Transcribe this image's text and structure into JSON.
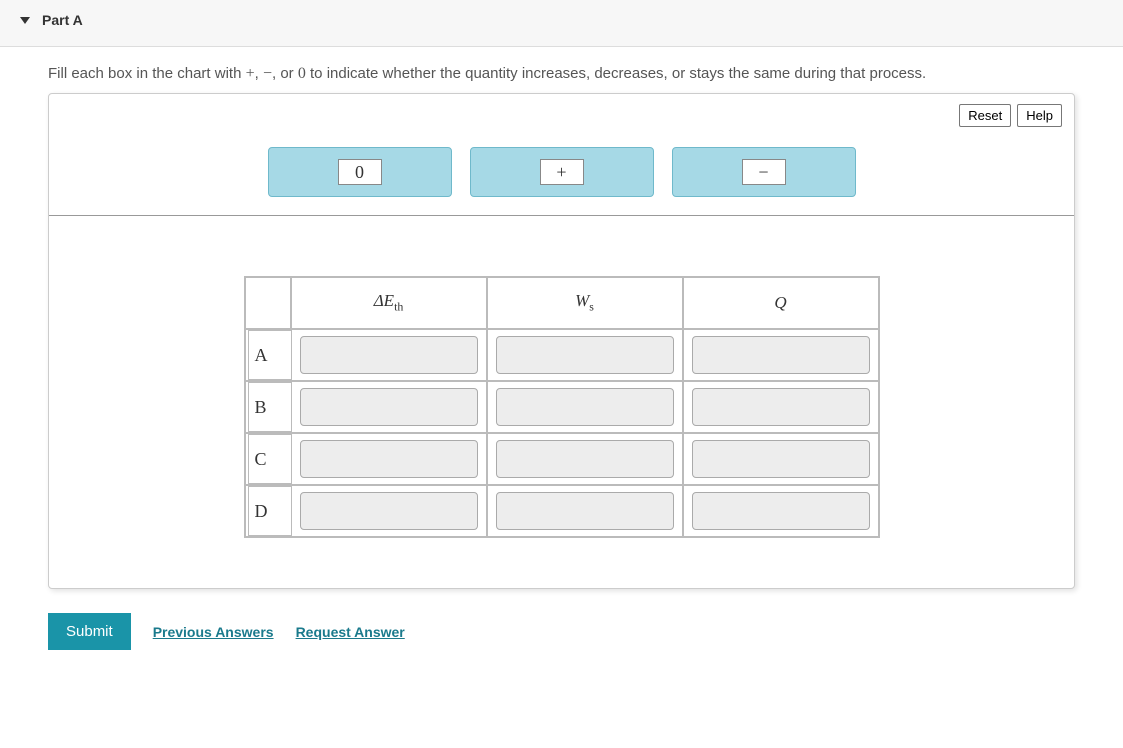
{
  "header": {
    "part_label": "Part A"
  },
  "instructions": {
    "prefix": "Fill each box in the chart with ",
    "sym_plus": "+",
    "sep1": ", ",
    "sym_minus": "−",
    "sep2": ", or ",
    "sym_zero": "0",
    "suffix": " to indicate whether the quantity increases, decreases, or stays the same during that process."
  },
  "panel": {
    "reset_label": "Reset",
    "help_label": "Help"
  },
  "source_bins": {
    "zero": "0",
    "plus": "+",
    "minus": "−"
  },
  "table": {
    "columns": {
      "dEth": {
        "delta": "Δ",
        "E": "E",
        "sub": "th"
      },
      "Ws": {
        "W": "W",
        "sub": "s"
      },
      "Q": {
        "Q": "Q"
      }
    },
    "rows": [
      "A",
      "B",
      "C",
      "D"
    ]
  },
  "footer": {
    "submit": "Submit",
    "previous": "Previous Answers",
    "request": "Request Answer"
  }
}
